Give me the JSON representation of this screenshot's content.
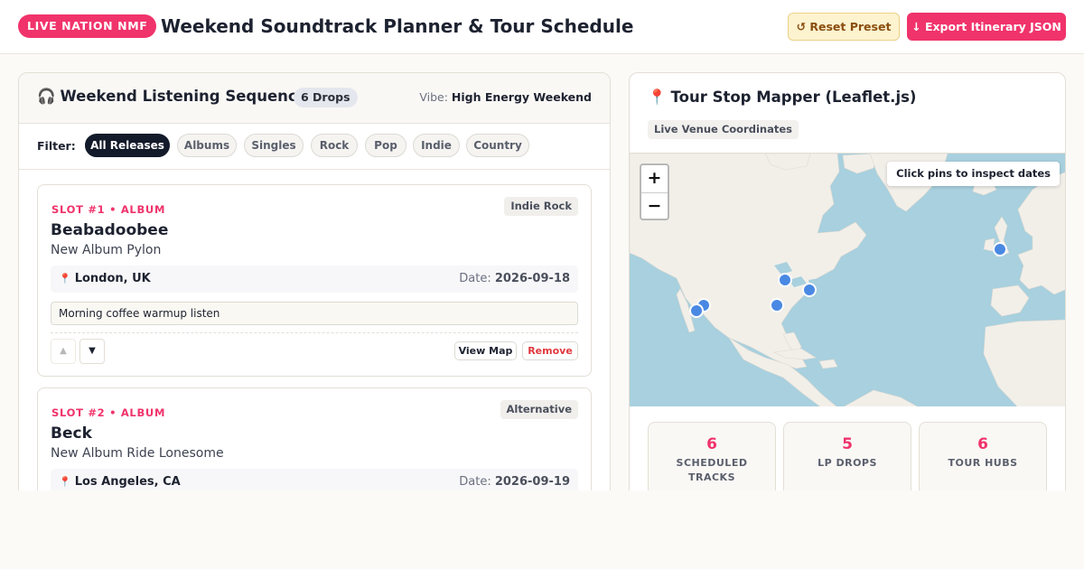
{
  "header": {
    "brand": "LIVE NATION NMF",
    "title": "Weekend Soundtrack Planner & Tour Schedule",
    "reset_label": "↺ Reset Preset",
    "export_label": "↓ Export Itinerary JSON"
  },
  "sequence": {
    "icon": "headphones-icon",
    "title": "Weekend Listening Sequence",
    "count_badge": "6 Drops",
    "vibe_label": "Vibe:",
    "vibe_value": "High Energy Weekend",
    "filter_label": "Filter:",
    "filters": [
      "All Releases",
      "Albums",
      "Singles",
      "Rock",
      "Pop",
      "Indie",
      "Country"
    ],
    "active_filter": "All Releases",
    "cards": [
      {
        "slot": "SLOT #1 • ALBUM",
        "genre": "Indie Rock",
        "artist": "Beabadoobee",
        "album": "New Album Pylon",
        "location": "London, UK",
        "date_label": "Date:",
        "date": "2026-09-18",
        "note": "Morning coffee warmup listen",
        "view_map": "View Map",
        "remove": "Remove"
      },
      {
        "slot": "SLOT #2 • ALBUM",
        "genre": "Alternative",
        "artist": "Beck",
        "album": "New Album Ride Lonesome",
        "location": "Los Angeles, CA",
        "date_label": "Date:",
        "date": "2026-09-19"
      }
    ]
  },
  "mapper": {
    "icon": "map-pin-icon",
    "title": "Tour Stop Mapper (Leaflet.js)",
    "sub_badge": "Live Venue Coordinates",
    "zoom_in": "+",
    "zoom_out": "−",
    "tooltip": "Click pins to inspect dates",
    "stats": [
      {
        "value": "6",
        "label": "SCHEDULED TRACKS"
      },
      {
        "value": "5",
        "label": "LP DROPS"
      },
      {
        "value": "6",
        "label": "TOUR HUBS"
      }
    ]
  },
  "colors": {
    "accent": "#f0336b",
    "dark": "#131a2a",
    "water": "#a8d0de",
    "land": "#f2efe9",
    "pin": "#4a89e3"
  }
}
